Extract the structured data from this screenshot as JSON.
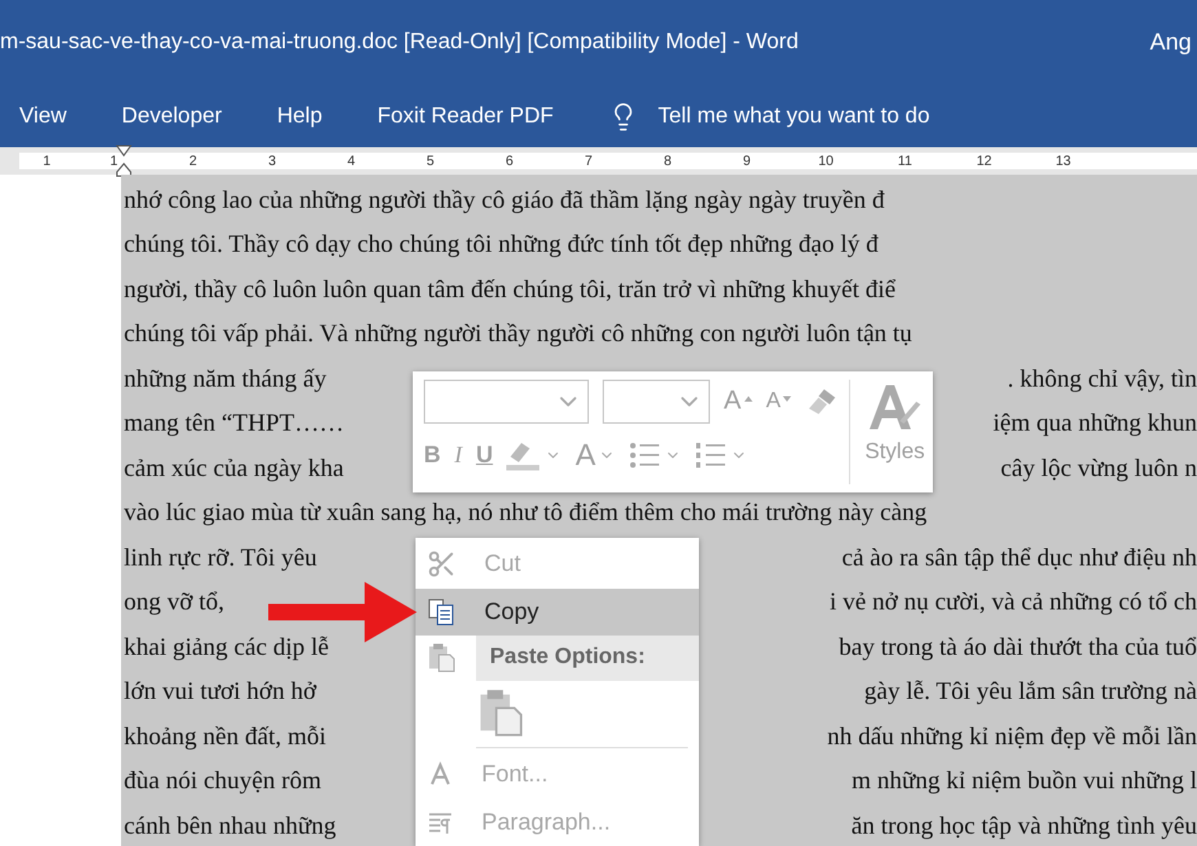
{
  "window": {
    "title": "m-sau-sac-ve-thay-co-va-mai-truong.doc [Read-Only] [Compatibility Mode]  -  Word",
    "user": "Ang"
  },
  "ribbon_tabs": [
    {
      "label": "View"
    },
    {
      "label": "Developer"
    },
    {
      "label": "Help"
    },
    {
      "label": "Foxit Reader PDF"
    }
  ],
  "tell_me": {
    "placeholder": "Tell me what you want to do"
  },
  "ruler": {
    "marks": [
      "1",
      "1",
      "2",
      "3",
      "4",
      "5",
      "6",
      "7",
      "8",
      "9",
      "10",
      "11",
      "12",
      "13"
    ]
  },
  "document": {
    "lines": [
      {
        "left": "nhớ công lao của những người thầy cô giáo đã thầm lặng ngày ngày truyền đ"
      },
      {
        "left": "chúng tôi. Thầy cô dạy cho chúng tôi những đức tính tốt đẹp những đạo lý đ"
      },
      {
        "left": "người, thầy cô luôn luôn quan tâm đến chúng tôi, trăn trở vì những khuyết điể"
      },
      {
        "left": "chúng tôi vấp phải. Và những người thầy người cô những con người luôn tận tụ"
      },
      {
        "left": "những năm tháng ấy",
        "right": ". không chỉ vậy, tìn"
      },
      {
        "left": "mang tên “THPT……",
        "right": "iệm qua những khun"
      },
      {
        "left": "cảm xúc của ngày kha",
        "right": "cây lộc vừng luôn n"
      },
      {
        "left": "vào lúc giao mùa từ xuân sang hạ, nó như tô điểm thêm cho mái trường này càng"
      },
      {
        "left": "linh rực rỡ. Tôi yêu",
        "right": "cả ào ra sân tập thể dục như điệu nh"
      },
      {
        "left": "ong vỡ tổ,",
        "right": "i vẻ nở nụ cười, và cả những có tổ ch"
      },
      {
        "left": "khai giảng các dịp lễ",
        "right": "bay trong tà áo dài thướt tha của tuổ"
      },
      {
        "left": "lớn vui tươi hớn hở",
        "right": "gày lễ. Tôi yêu lắm sân trường nà"
      },
      {
        "left": "khoảng nền đất, mỗi",
        "right": "nh dấu những kỉ niệm đẹp về mỗi lần"
      },
      {
        "left": "đùa nói chuyện rôm",
        "right": "m những kỉ niệm buồn vui những l"
      },
      {
        "left": "cánh bên nhau những",
        "right": "ăn trong học tập và những tình yêu"
      }
    ]
  },
  "mini_toolbar": {
    "row_1": [
      {
        "kind": "font-field"
      },
      {
        "kind": "size-field"
      },
      {
        "kind": "grow",
        "label": "A"
      },
      {
        "kind": "shrink",
        "label": "A"
      },
      {
        "kind": "painter"
      }
    ],
    "row_2": [
      {
        "kind": "bold",
        "label": "B"
      },
      {
        "kind": "italic",
        "label": "I"
      },
      {
        "kind": "underline",
        "label": "U"
      },
      {
        "kind": "highlight"
      },
      {
        "kind": "font-color",
        "label": "A"
      },
      {
        "kind": "bullets"
      },
      {
        "kind": "numbering"
      }
    ],
    "styles": {
      "label": "Styles"
    }
  },
  "context_menu": [
    {
      "kind": "cut",
      "label": "Cut",
      "disabled": true,
      "selected": false
    },
    {
      "kind": "copy",
      "label": "Copy",
      "disabled": false,
      "selected": true
    },
    {
      "kind": "header",
      "label": "Paste Options:"
    },
    {
      "kind": "paste"
    },
    {
      "kind": "separator"
    },
    {
      "kind": "font",
      "label": "Font...",
      "disabled": true,
      "selected": false
    },
    {
      "kind": "paragraph",
      "label": "Paragraph...",
      "disabled": true,
      "selected": false
    }
  ]
}
